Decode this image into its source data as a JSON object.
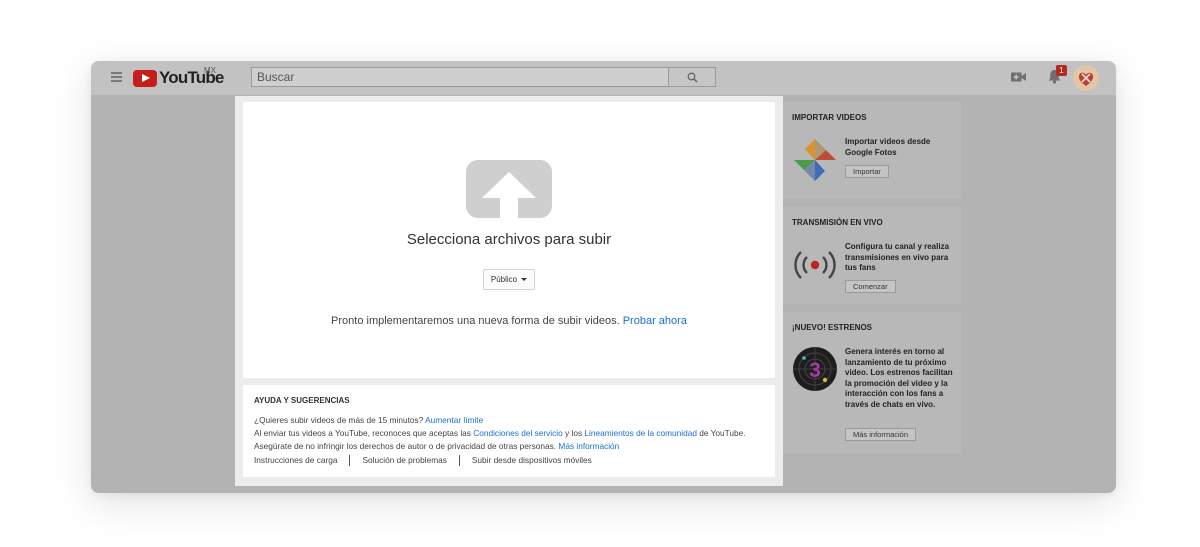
{
  "header": {
    "logo_text": "YouTube",
    "country": "MX",
    "search_placeholder": "Buscar",
    "notification_count": "1"
  },
  "upload": {
    "title": "Selecciona archivos para subir",
    "privacy_label": "Público",
    "new_way_text": "Pronto implementaremos una nueva forma de subir videos.",
    "try_now": "Probar ahora"
  },
  "help": {
    "title": "AYUDA Y SUGERENCIAS",
    "line1_text": "¿Quieres subir videos de más de 15 minutos?",
    "line1_link": "Aumentar límite",
    "line2_pre": "Al enviar tus videos a YouTube, reconoces que aceptas las",
    "line2_link1": "Condiciones del servicio",
    "line2_mid": "y los",
    "line2_link2": "Lineamientos de la comunidad",
    "line2_post": "de YouTube.",
    "line3_text": "Asegúrate de no infringir los derechos de autor o de privacidad de otras personas.",
    "line3_link": "Más información",
    "links": [
      "Instrucciones de carga",
      "Solución de problemas",
      "Subir desde dispositivos móviles"
    ]
  },
  "sidebar": {
    "import": {
      "title": "IMPORTAR VIDEOS",
      "text": "Importar videos desde Google Fotos",
      "button": "Importar"
    },
    "live": {
      "title": "TRANSMISIÓN EN VIVO",
      "text": "Configura tu canal y realiza transmisiones en vivo para tus fans",
      "button": "Comenzar"
    },
    "premieres": {
      "title": "¡NUEVO! ESTRENOS",
      "text": "Genera interés en torno al lanzamiento de tu próximo video. Los estrenos facilitan la promoción del video y la interacción con los fans a través de chats en vivo.",
      "button": "Más información",
      "icon_number": "3"
    }
  },
  "colors": {
    "accent_link": "#1b6fd1",
    "brand_red": "#c41f1a",
    "overlay": "#b3b3b3"
  }
}
